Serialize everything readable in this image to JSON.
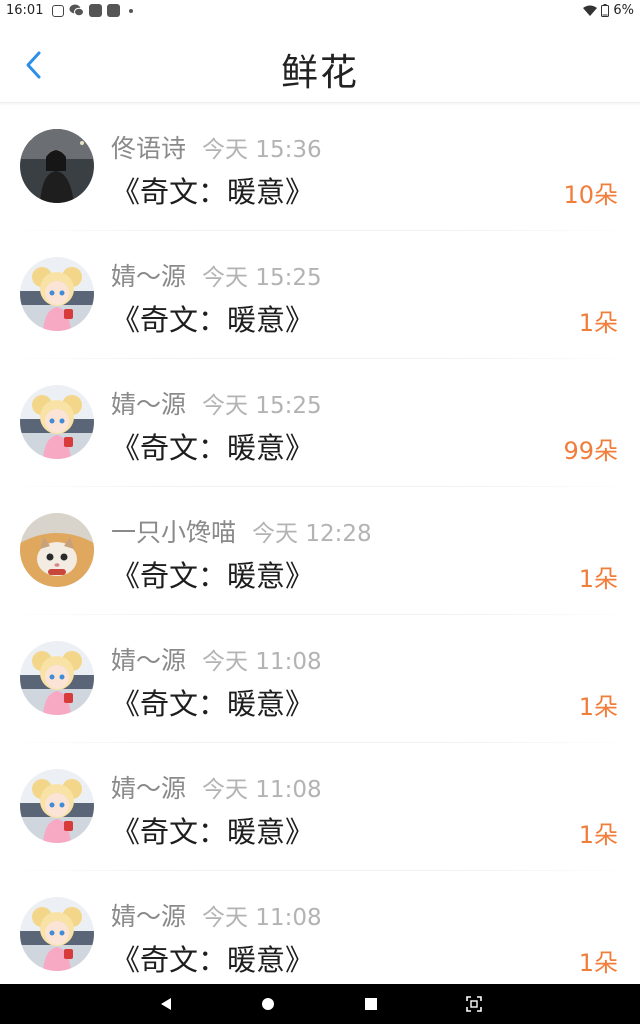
{
  "status_bar": {
    "time": "16:01",
    "battery": "6%",
    "icons": [
      "notification-icon",
      "wechat-icon",
      "app-icon",
      "app-icon",
      "dot-icon",
      "wifi-icon",
      "battery-icon"
    ]
  },
  "header": {
    "title": "鲜花",
    "back_icon": "chevron-left-icon",
    "accent": "#2b8ee8"
  },
  "rows": [
    {
      "name": "佟语诗",
      "time": "今天 15:36",
      "book": "《奇文：暖意》",
      "count": "10朵",
      "avatar": "photo"
    },
    {
      "name": "婧～源",
      "time": "今天 15:25",
      "book": "《奇文：暖意》",
      "count": "1朵",
      "avatar": "anime"
    },
    {
      "name": "婧～源",
      "time": "今天 15:25",
      "book": "《奇文：暖意》",
      "count": "99朵",
      "avatar": "anime"
    },
    {
      "name": "一只小馋喵",
      "time": "今天 12:28",
      "book": "《奇文：暖意》",
      "count": "1朵",
      "avatar": "cat"
    },
    {
      "name": "婧～源",
      "time": "今天 11:08",
      "book": "《奇文：暖意》",
      "count": "1朵",
      "avatar": "anime"
    },
    {
      "name": "婧～源",
      "time": "今天 11:08",
      "book": "《奇文：暖意》",
      "count": "1朵",
      "avatar": "anime"
    },
    {
      "name": "婧～源",
      "time": "今天 11:08",
      "book": "《奇文：暖意》",
      "count": "1朵",
      "avatar": "anime"
    }
  ],
  "colors": {
    "count": "#f27d3b",
    "name": "#8a8a8a",
    "time": "#b3b3b3"
  },
  "nav_bar": {
    "buttons": [
      "back-triangle-icon",
      "home-circle-icon",
      "recents-square-icon",
      "screenshot-icon"
    ]
  }
}
